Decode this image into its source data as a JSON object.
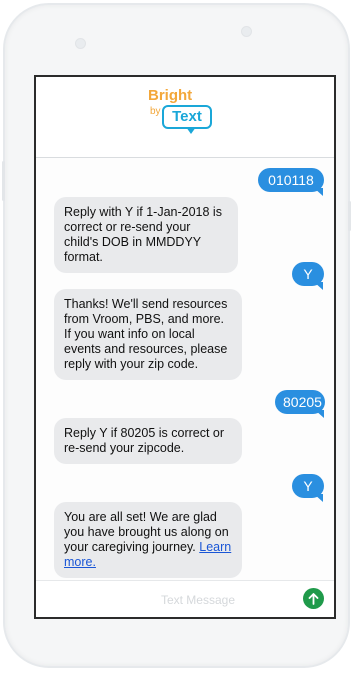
{
  "app": {
    "logo_word1": "Bright",
    "logo_by": "by",
    "logo_word2": "Text"
  },
  "colors": {
    "outgoing_bubble": "#2a8fe0",
    "incoming_bubble": "#e9eaec",
    "send_button": "#1f9a4a",
    "logo_orange": "#f3a73a",
    "logo_blue": "#1aa7d8"
  },
  "conversation": {
    "messages": [
      {
        "direction": "out",
        "text": "010118"
      },
      {
        "direction": "in",
        "text": "Reply with Y if 1-Jan-2018 is correct or re-send your child's DOB in MMDDYY format."
      },
      {
        "direction": "out",
        "text": "Y"
      },
      {
        "direction": "in",
        "text": "Thanks! We'll send resources from Vroom, PBS, and more. If you want info on local events and resources, please reply with your zip code."
      },
      {
        "direction": "out",
        "text": "80205"
      },
      {
        "direction": "in",
        "text": "Reply Y if 80205 is correct or re-send your zipcode."
      },
      {
        "direction": "out",
        "text": "Y"
      },
      {
        "direction": "in",
        "text": "You are all set!  We are glad you have brought us along on your caregiving journey. ",
        "link": "Learn more."
      }
    ]
  },
  "composer": {
    "placeholder": "Text Message",
    "send_icon": "arrow-up-icon"
  }
}
